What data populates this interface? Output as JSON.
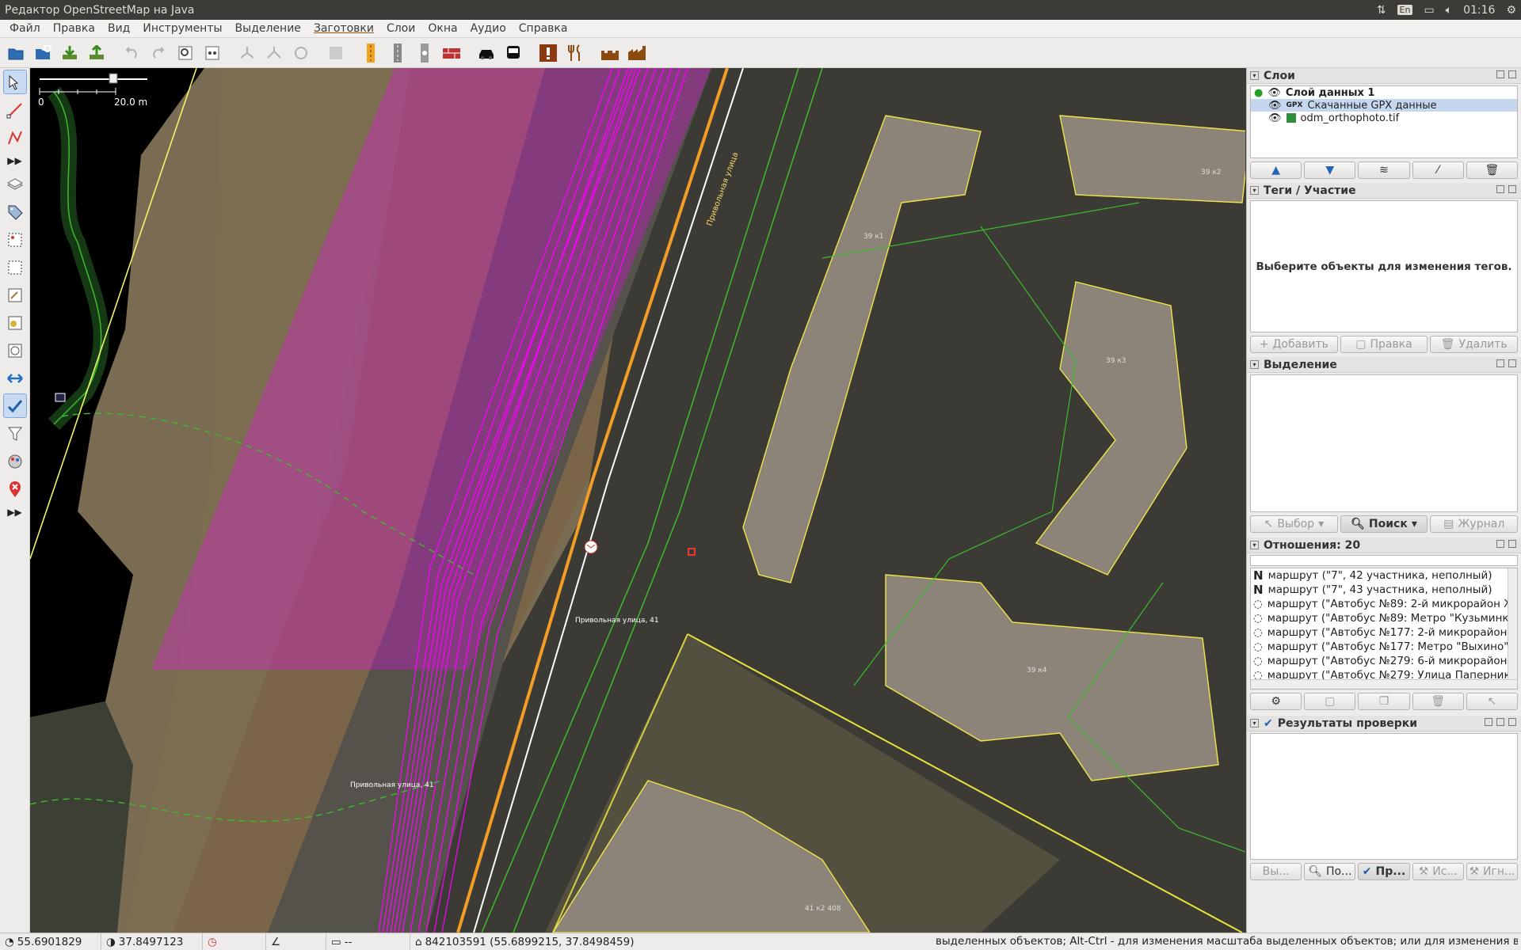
{
  "window": {
    "title": "Редактор OpenStreetMap на Java"
  },
  "tray": {
    "lang": "En",
    "time": "01:16"
  },
  "menu": [
    "Файл",
    "Правка",
    "Вид",
    "Инструменты",
    "Выделение",
    "Заготовки",
    "Слои",
    "Окна",
    "Аудио",
    "Справка"
  ],
  "toolbar_icons": [
    "open-file-icon",
    "open-location-icon",
    "download-icon",
    "upload-icon",
    "undo-icon",
    "redo-icon",
    "preferences-icon",
    "zoom-icon",
    "combine-way-icon",
    "split-way-icon",
    "reverse-way-icon",
    "relation-icon",
    "preset-highway-icon",
    "preset-road-icon",
    "preset-traffic-signals-icon",
    "preset-barrier-icon",
    "preset-car-icon",
    "preset-bus-icon",
    "preset-hazard-icon",
    "preset-restaurant-icon",
    "preset-castle-icon",
    "preset-industrial-icon"
  ],
  "map": {
    "scale": {
      "zero": "0",
      "distance": "20.0 m"
    },
    "labels": {
      "street_name": "Привольная улица",
      "addr_1": "Привольная улица, 41",
      "addr_2": "Привольная улица, 41",
      "bldg_1": "39 к1",
      "bldg_2": "39 к2",
      "bldg_3": "39 к3",
      "bldg_4": "39 к4",
      "bldg_5": "41 к2 408"
    }
  },
  "layers": {
    "title": "Слои",
    "items": [
      {
        "name": "Слой данных 1",
        "active": true
      },
      {
        "name": "Скачанные GPX данные",
        "selected": true
      },
      {
        "name": "odm_orthophoto.tif"
      }
    ]
  },
  "tags": {
    "title": "Теги / Участие",
    "placeholder": "Выберите объекты для изменения тегов.",
    "buttons": [
      "Добавить",
      "Правка",
      "Удалить"
    ]
  },
  "selection": {
    "title": "Выделение",
    "buttons": [
      "Выбор",
      "Поиск",
      "Журнал"
    ]
  },
  "relations": {
    "title": "Отношения: 20",
    "items": [
      "маршрут (\"7\", 42 участника, неполный)",
      "маршрут (\"7\", 43 участника, неполный)",
      "маршрут (\"Автобус №89: 2-й микрорайон Ж",
      "маршрут (\"Автобус №89: Метро \"Кузьминк",
      "маршрут (\"Автобус №177: 2-й микрорайон",
      "маршрут (\"Автобус №177: Метро \"Выхино\"",
      "маршрут (\"Автобус №279: 6-й микрорайон",
      "маршрут (\"Автобус №279: Улица Паперник"
    ]
  },
  "validation": {
    "title": "Результаты проверки"
  },
  "bottom_tabs": [
    "Вы...",
    "По...",
    "Пр...",
    "Ис...",
    "Игн..."
  ],
  "status": {
    "lat": "55.6901829",
    "lon": "37.8497123",
    "heading": "",
    "angle": "",
    "distance": "--",
    "object": "842103591 (55.6899215, 37.8498459)",
    "help": "выделенных объектов; Alt-Ctrl - для изменения масштаба выделенных объектов; или для изменения выделения"
  }
}
